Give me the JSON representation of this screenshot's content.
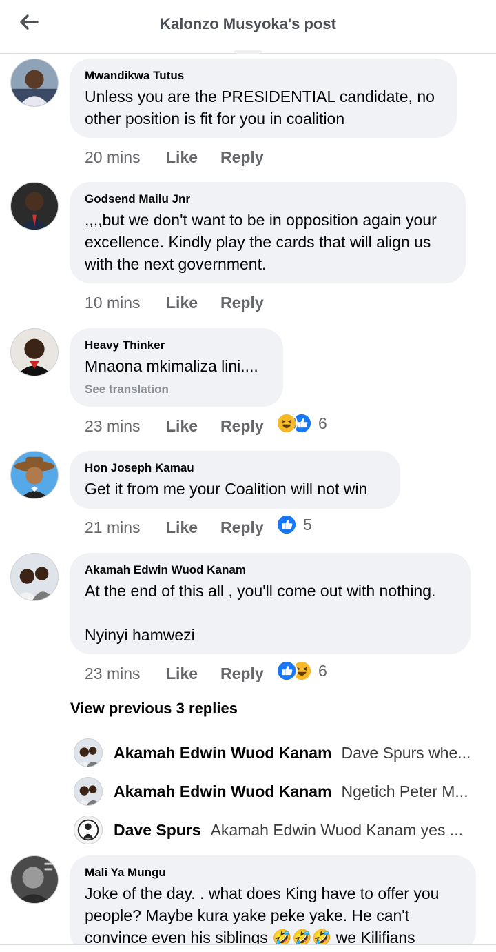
{
  "header": {
    "title": "Kalonzo Musyoka's post"
  },
  "comments": [
    {
      "author": "Mwandikwa Tutus",
      "text": "Unless you are the PRESIDENTIAL candidate, no\nother position is fit for you in coalition",
      "time": "20 mins",
      "like": "Like",
      "reply": "Reply"
    },
    {
      "author": "Godsend Mailu Jnr",
      "text": ",,,,but we don't want to be in opposition again your\nexcellence. Kindly play the cards that will align us\nwith the next government.",
      "time": "10 mins",
      "like": "Like",
      "reply": "Reply"
    },
    {
      "author": "Heavy Thinker",
      "text": "Mnaona mkimaliza lini....",
      "see_translation": "See translation",
      "time": "23 mins",
      "like": "Like",
      "reply": "Reply",
      "reaction_count": "6",
      "reactions": [
        "haha-icon",
        "like-icon"
      ]
    },
    {
      "author": "Hon Joseph Kamau",
      "text": "Get it from me your Coalition will not win",
      "time": "21 mins",
      "like": "Like",
      "reply": "Reply",
      "reaction_count": "5",
      "reactions": [
        "like-icon"
      ]
    },
    {
      "author": "Akamah Edwin Wuod Kanam",
      "text": "At the end of this all , you'll come out with nothing.\n\nNyinyi hamwezi",
      "time": "23 mins",
      "like": "Like",
      "reply": "Reply",
      "reaction_count": "6",
      "reactions": [
        "like-icon",
        "haha-icon"
      ]
    },
    {
      "author": "Mali Ya Mungu",
      "text": "Joke of the day. .  what does King have to offer you\npeople? Maybe kura yake peke yake. He can't\nconvince even his siblings 🤣🤣🤣 we Kilifians"
    }
  ],
  "view_previous": "View previous 3 replies",
  "replies": [
    {
      "name": "Akamah Edwin Wuod Kanam",
      "snippet": "Dave Spurs whe..."
    },
    {
      "name": "Akamah Edwin Wuod Kanam",
      "snippet": "Ngetich Peter M..."
    },
    {
      "name": "Dave Spurs",
      "snippet": "Akamah Edwin Wuod Kanam yes ..."
    }
  ],
  "colors": {
    "like_blue": "#1877f2",
    "haha_yellow": "#f7b928",
    "bubble_bg": "#f0f2f5",
    "meta_gray": "#65676b"
  }
}
